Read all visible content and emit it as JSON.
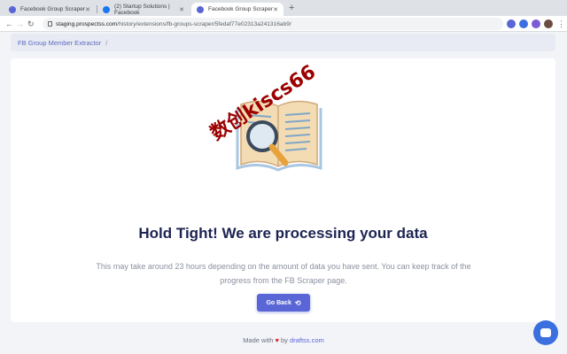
{
  "browser": {
    "tabs": [
      {
        "label": "Facebook Group Scraper",
        "active": false
      },
      {
        "label": "(2) Startup Solutions | Facebook",
        "active": false
      },
      {
        "label": "Facebook Group Scraper",
        "active": true
      }
    ],
    "url_host": "staging.prospectss.com",
    "url_path": "/history/extensions/fb-groups-scraper/5fedaf77e02313a241316ab9/"
  },
  "breadcrumb": {
    "item": "FB Group Member Extractor",
    "separator": "/"
  },
  "main": {
    "watermark": "数创kiscs66",
    "title": "Hold Tight! We are processing your data",
    "description": "This may take around 23 hours depending on the amount of data you have sent. You can keep track of the progress from the FB Scraper page.",
    "button_label": "Go Back"
  },
  "footer": {
    "prefix": "Made with",
    "by": "by",
    "brand": "draftss.com"
  },
  "icons": {
    "heart": "heart-icon",
    "back": "undo-icon",
    "chat": "chat-icon",
    "illustration": "book-magnifier-icon"
  },
  "colors": {
    "accent": "#5a66d6",
    "title": "#1d2452",
    "watermark": "#9c0000"
  }
}
